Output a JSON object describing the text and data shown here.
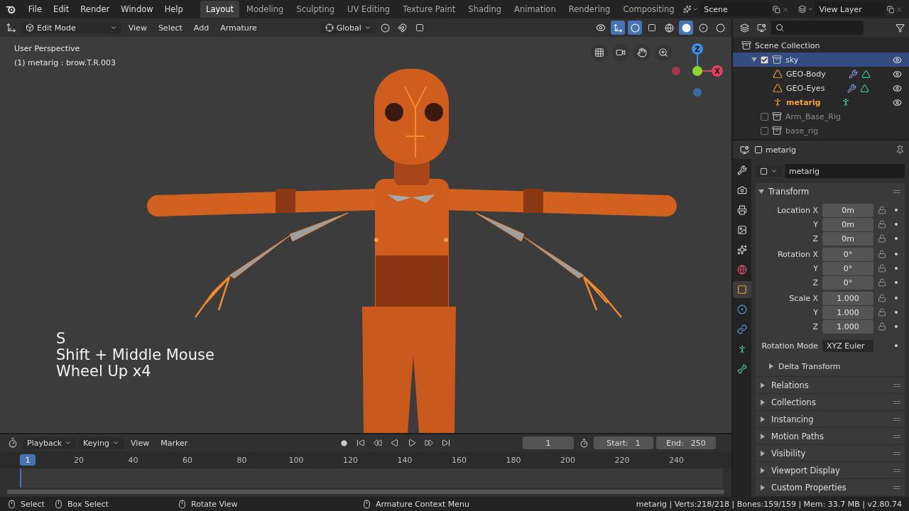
{
  "menu_bar": {
    "menus": [
      "File",
      "Edit",
      "Render",
      "Window",
      "Help"
    ],
    "workspaces": [
      {
        "label": "Layout",
        "selected": true
      },
      {
        "label": "Modeling",
        "selected": false
      },
      {
        "label": "Sculpting",
        "selected": false
      },
      {
        "label": "UV Editing",
        "selected": false
      },
      {
        "label": "Texture Paint",
        "selected": false
      },
      {
        "label": "Shading",
        "selected": false
      },
      {
        "label": "Animation",
        "selected": false
      },
      {
        "label": "Rendering",
        "selected": false
      },
      {
        "label": "Compositing",
        "selected": false
      }
    ],
    "scene": "Scene",
    "view_layer": "View Layer"
  },
  "viewport_header": {
    "mode": "Edit Mode",
    "menus": [
      "View",
      "Select",
      "Add",
      "Armature"
    ],
    "orientation": "Global"
  },
  "viewport": {
    "perspective": "User Perspective",
    "active_item": "(1) metarig : brow.T.R.003",
    "keystrokes": [
      "S",
      "Shift + Middle Mouse",
      "Wheel Up x4"
    ],
    "gizmo_z": "Z",
    "gizmo_x": "X"
  },
  "outliner": {
    "root": "Scene Collection",
    "items": [
      {
        "name": "sky",
        "kind": "collection",
        "checked": true,
        "selected": true,
        "expanded": true,
        "children": [
          {
            "name": "GEO-Body",
            "kind": "mesh",
            "active": false
          },
          {
            "name": "GEO-Eyes",
            "kind": "mesh",
            "active": false
          },
          {
            "name": "metarig",
            "kind": "armature",
            "active": true
          }
        ]
      },
      {
        "name": "Arm_Base_Rig",
        "kind": "collection",
        "checked": false,
        "selected": false
      },
      {
        "name": "base_rig",
        "kind": "collection",
        "checked": false,
        "selected": false
      }
    ]
  },
  "properties": {
    "object_name": "metarig",
    "datablock": "metarig",
    "tabs": [
      {
        "kind": "tool",
        "selected": false
      },
      {
        "kind": "render",
        "selected": false
      },
      {
        "kind": "output",
        "selected": false
      },
      {
        "kind": "view_layer",
        "selected": false
      },
      {
        "kind": "scene",
        "selected": false
      },
      {
        "kind": "world",
        "selected": false
      },
      {
        "kind": "object",
        "selected": true
      },
      {
        "kind": "physics",
        "selected": false
      },
      {
        "kind": "constraints",
        "selected": false
      },
      {
        "kind": "data",
        "selected": false
      },
      {
        "kind": "bone",
        "selected": false
      }
    ],
    "transform": {
      "title": "Transform",
      "expanded": true,
      "rows": [
        {
          "label": "Location X",
          "value": "0m"
        },
        {
          "label": "Y",
          "value": "0m"
        },
        {
          "label": "Z",
          "value": "0m"
        },
        {
          "label": "Rotation X",
          "value": "0°"
        },
        {
          "label": "Y",
          "value": "0°"
        },
        {
          "label": "Z",
          "value": "0°"
        },
        {
          "label": "Scale X",
          "value": "1.000"
        },
        {
          "label": "Y",
          "value": "1.000"
        },
        {
          "label": "Z",
          "value": "1.000"
        }
      ],
      "rotation_mode_label": "Rotation Mode",
      "rotation_mode": "XYZ Euler",
      "subpanel": "Delta Transform"
    },
    "panels": [
      "Relations",
      "Collections",
      "Instancing",
      "Motion Paths",
      "Visibility",
      "Viewport Display",
      "Custom Properties"
    ]
  },
  "timeline": {
    "menus": [
      "Playback",
      "Keying",
      "View",
      "Marker"
    ],
    "current_frame": "1",
    "start_label": "Start:",
    "start": "1",
    "end_label": "End:",
    "end": "250",
    "playhead": "1",
    "ticks": [
      "20",
      "40",
      "60",
      "80",
      "100",
      "120",
      "140",
      "160",
      "180",
      "200",
      "220",
      "240"
    ]
  },
  "status_bar": {
    "hints": [
      {
        "kind": "left",
        "label": "Select"
      },
      {
        "kind": "box",
        "label": "Box Select"
      },
      {
        "kind": "middle",
        "label": "Rotate View"
      },
      {
        "kind": "right",
        "label": "Armature Context Menu"
      }
    ],
    "stats": "metarig | Verts:218/218 | Bones:159/159 | Mem: 33.7 MB | v2.80.74"
  }
}
